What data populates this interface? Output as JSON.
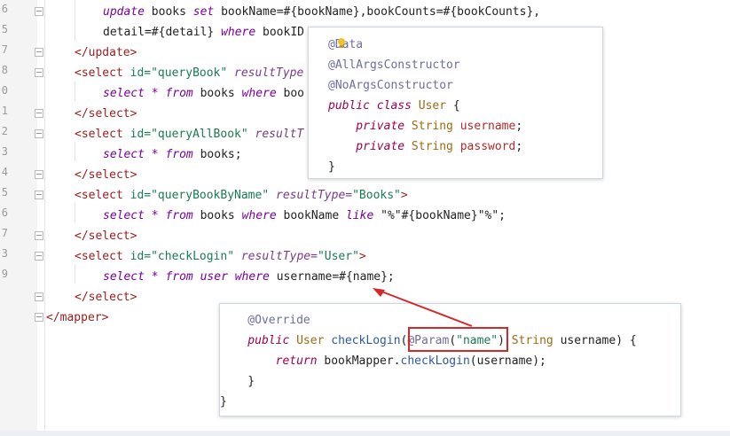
{
  "line_numbers": [
    "6",
    "5",
    "7",
    "8",
    "0",
    "1",
    "2",
    "3",
    "4",
    "5",
    "6",
    "7",
    "3",
    "9"
  ],
  "code_lines": [
    [
      {
        "t": "update",
        "c": "kw"
      },
      {
        "t": " books ",
        "c": "plain"
      },
      {
        "t": "set",
        "c": "kw"
      },
      {
        "t": " bookName=#{bookName},bookCounts=#{bookCounts},",
        "c": "plain"
      }
    ],
    [
      {
        "t": "detail=#{detail} ",
        "c": "plain"
      },
      {
        "t": "where",
        "c": "kw"
      },
      {
        "t": " bookID",
        "c": "plain"
      }
    ],
    [
      {
        "t": "</",
        "c": "tag"
      },
      {
        "t": "update",
        "c": "tag"
      },
      {
        "t": ">",
        "c": "tag"
      }
    ],
    [
      {
        "t": "<select ",
        "c": "tag"
      },
      {
        "t": "id=",
        "c": "attr"
      },
      {
        "t": "\"queryBook\"",
        "c": "str"
      },
      {
        "t": " resultType",
        "c": "attrn"
      }
    ],
    [
      {
        "t": "select",
        "c": "kw"
      },
      {
        "t": " * ",
        "c": "kw"
      },
      {
        "t": "from",
        "c": "kw"
      },
      {
        "t": " books ",
        "c": "plain"
      },
      {
        "t": "where",
        "c": "kw"
      },
      {
        "t": " boo",
        "c": "plain"
      }
    ],
    [
      {
        "t": "</select>",
        "c": "tag"
      }
    ],
    [
      {
        "t": "<select ",
        "c": "tag"
      },
      {
        "t": "id=",
        "c": "attr"
      },
      {
        "t": "\"queryAllBook\"",
        "c": "str"
      },
      {
        "t": " resultT",
        "c": "attrn"
      }
    ],
    [
      {
        "t": "select",
        "c": "kw"
      },
      {
        "t": " * ",
        "c": "kw"
      },
      {
        "t": "from",
        "c": "kw"
      },
      {
        "t": " books;",
        "c": "plain"
      }
    ],
    [
      {
        "t": "</select>",
        "c": "tag"
      }
    ],
    [
      {
        "t": "<select ",
        "c": "tag"
      },
      {
        "t": "id=",
        "c": "attr"
      },
      {
        "t": "\"queryBookByName\"",
        "c": "str"
      },
      {
        "t": " resultType=",
        "c": "attrn"
      },
      {
        "t": "\"Books\"",
        "c": "str"
      },
      {
        "t": ">",
        "c": "tag"
      }
    ],
    [
      {
        "t": "select",
        "c": "kw"
      },
      {
        "t": " * ",
        "c": "kw"
      },
      {
        "t": "from",
        "c": "kw"
      },
      {
        "t": " books ",
        "c": "plain"
      },
      {
        "t": "where",
        "c": "kw"
      },
      {
        "t": " bookName ",
        "c": "plain"
      },
      {
        "t": "like",
        "c": "kw"
      },
      {
        "t": " \"%\"#{bookName}\"%\";",
        "c": "plain"
      }
    ],
    [
      {
        "t": "</select>",
        "c": "tag"
      }
    ],
    [
      {
        "t": "<select ",
        "c": "tag"
      },
      {
        "t": "id=",
        "c": "attr"
      },
      {
        "t": "\"checkLogin\"",
        "c": "str"
      },
      {
        "t": " resultType=",
        "c": "attrn"
      },
      {
        "t": "\"User\"",
        "c": "str"
      },
      {
        "t": ">",
        "c": "tag"
      }
    ],
    [
      {
        "t": "select",
        "c": "kw"
      },
      {
        "t": " * ",
        "c": "kw"
      },
      {
        "t": "from",
        "c": "kw"
      },
      {
        "t": " user ",
        "c": "kw"
      },
      {
        "t": "where",
        "c": "kw"
      },
      {
        "t": " username=#{name};",
        "c": "plain"
      }
    ],
    [
      {
        "t": "</select>",
        "c": "tag"
      }
    ],
    [
      {
        "t": "</mapper>",
        "c": "tag"
      }
    ]
  ],
  "popup1_lines": [
    [
      {
        "t": "@Data",
        "c": "ann"
      }
    ],
    [
      {
        "t": "@AllArgsConstructor",
        "c": "ann"
      }
    ],
    [
      {
        "t": "@NoArgsConstructor",
        "c": "ann"
      }
    ],
    [
      {
        "t": "public",
        "c": "jkw"
      },
      {
        "t": " ",
        "c": "jtext"
      },
      {
        "t": "class",
        "c": "jkw"
      },
      {
        "t": " ",
        "c": "jtext"
      },
      {
        "t": "User",
        "c": "jtype"
      },
      {
        "t": " {",
        "c": "jtext"
      }
    ],
    [
      {
        "t": "    private",
        "c": "jkw"
      },
      {
        "t": " String ",
        "c": "jtype"
      },
      {
        "t": "username",
        "c": "jfield"
      },
      {
        "t": ";",
        "c": "jtext"
      }
    ],
    [
      {
        "t": "    private",
        "c": "jkw"
      },
      {
        "t": " String ",
        "c": "jtype"
      },
      {
        "t": "password",
        "c": "jfield"
      },
      {
        "t": ";",
        "c": "jtext"
      }
    ],
    [
      {
        "t": "}",
        "c": "jtext"
      }
    ]
  ],
  "popup2_lines": [
    [
      {
        "t": "    @Override",
        "c": "ann"
      }
    ],
    [
      {
        "t": "    public",
        "c": "jkw"
      },
      {
        "t": " User ",
        "c": "jtype"
      },
      {
        "t": "checkLogin",
        "c": "jmeth"
      },
      {
        "t": "(",
        "c": "jtext"
      },
      {
        "t": "@Param",
        "c": "ann"
      },
      {
        "t": "(",
        "c": "jtext"
      },
      {
        "t": "\"name\"",
        "c": "jstr"
      },
      {
        "t": ")",
        "c": "jtext"
      },
      {
        "t": " String ",
        "c": "jtype"
      },
      {
        "t": "username) {",
        "c": "jtext"
      }
    ],
    [
      {
        "t": "        return",
        "c": "jkw"
      },
      {
        "t": " bookMapper.",
        "c": "jtext"
      },
      {
        "t": "checkLogin",
        "c": "jmeth"
      },
      {
        "t": "(username);",
        "c": "jtext"
      }
    ],
    [
      {
        "t": "    }",
        "c": "jtext"
      }
    ],
    [
      {
        "t": "}",
        "c": "jtext"
      }
    ]
  ],
  "colors": {
    "arrow": "#d62828",
    "highlight_box": "#d62828"
  }
}
